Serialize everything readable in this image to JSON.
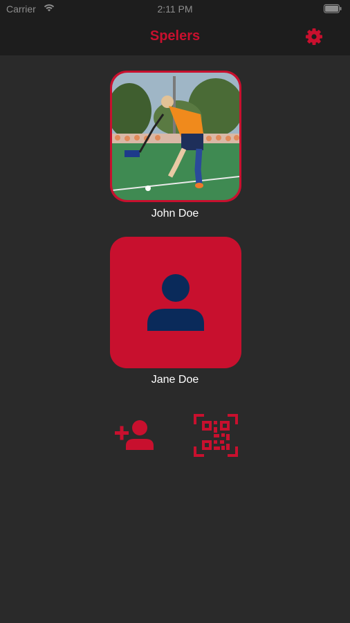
{
  "status_bar": {
    "carrier": "Carrier",
    "time": "2:11 PM"
  },
  "nav": {
    "title": "Spelers",
    "settings_icon": "gear-icon"
  },
  "players": [
    {
      "name": "John Doe",
      "has_photo": true
    },
    {
      "name": "Jane Doe",
      "has_photo": false
    }
  ],
  "actions": {
    "add_player_icon": "add-person-icon",
    "scan_qr_icon": "qr-scan-icon"
  },
  "colors": {
    "accent": "#c8102e",
    "background": "#2a2a2a",
    "bar": "#1d1d1d",
    "avatar_figure": "#0a2a5a"
  }
}
